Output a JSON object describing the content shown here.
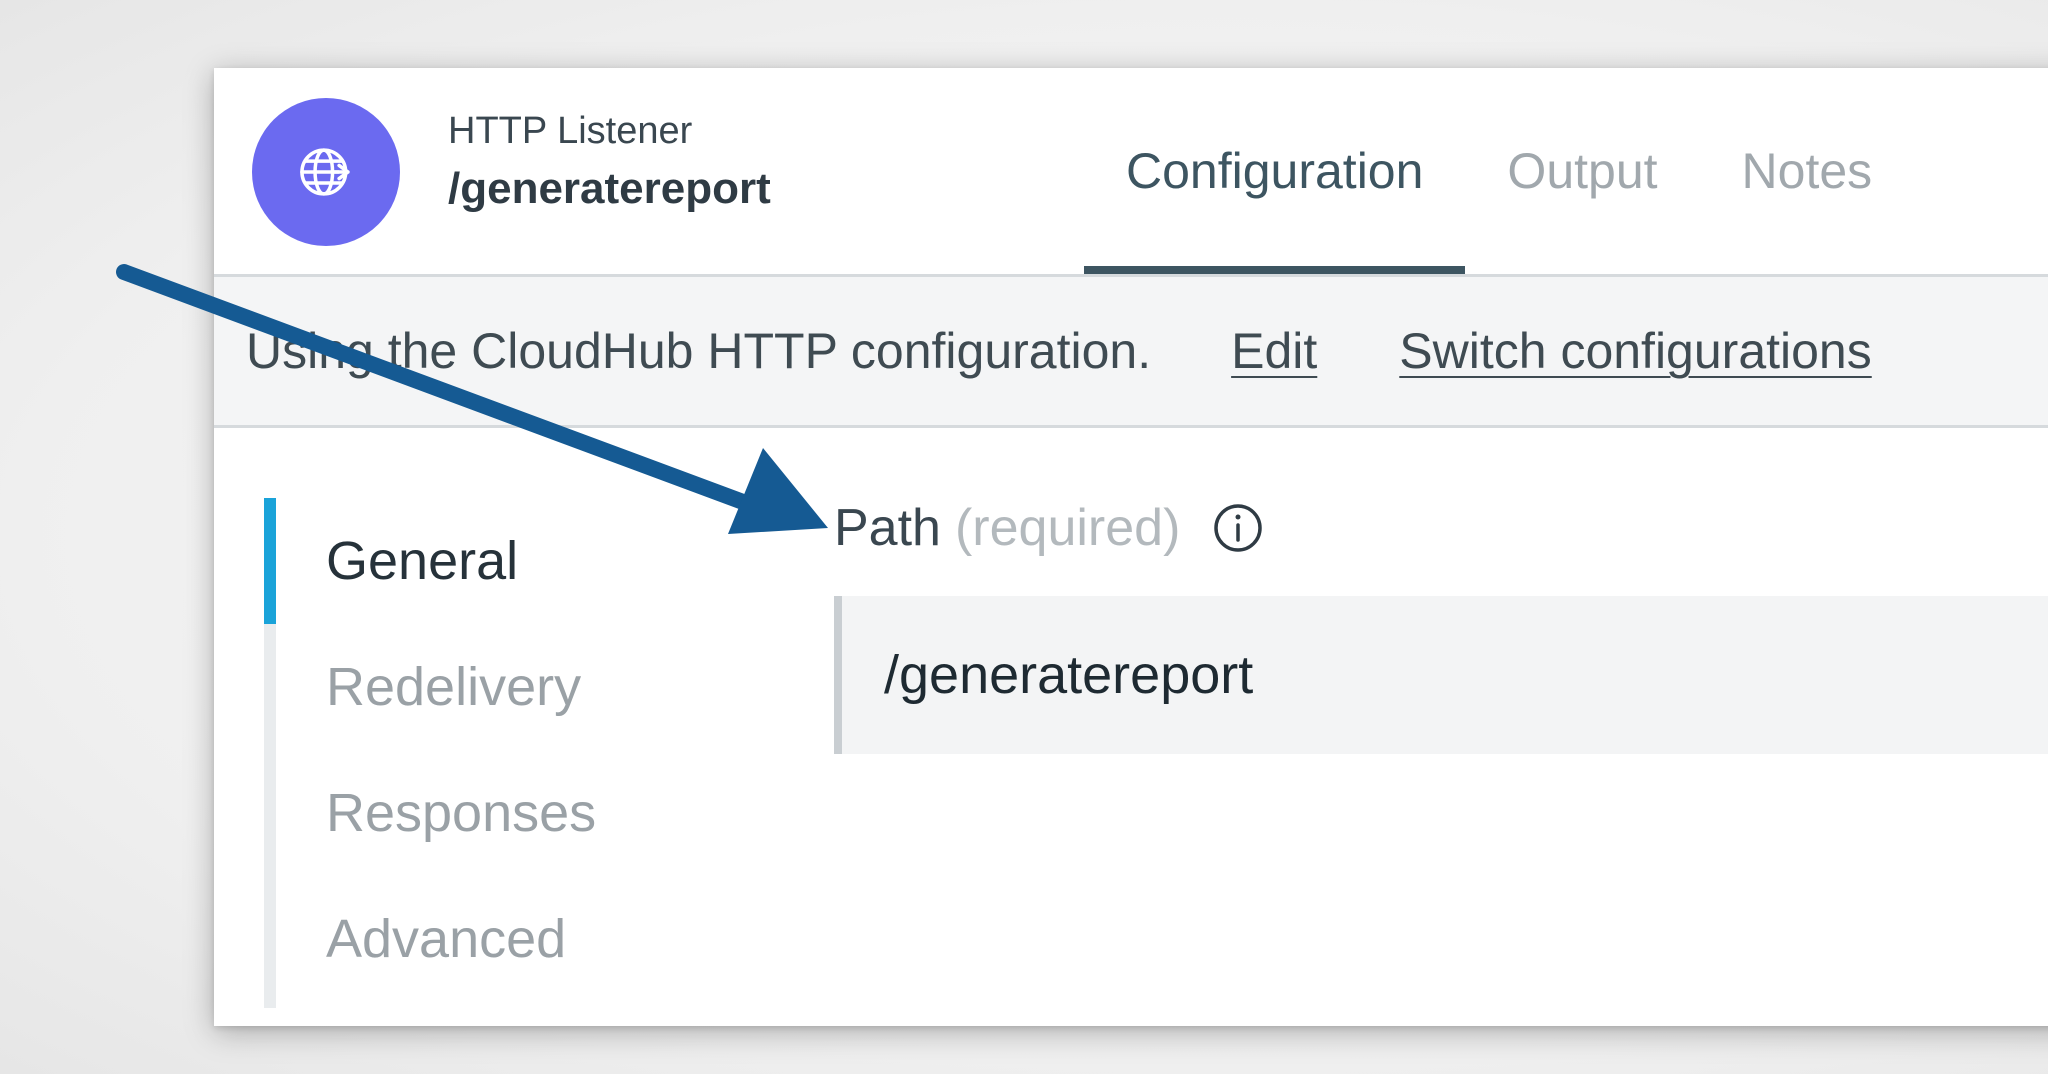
{
  "header": {
    "component_type": "HTTP Listener",
    "component_name": "/generatereport",
    "icon": "globe-arrow-icon",
    "icon_color": "#6b6af0"
  },
  "tabs": [
    {
      "label": "Configuration",
      "active": true
    },
    {
      "label": "Output",
      "active": false
    },
    {
      "label": "Notes",
      "active": false
    }
  ],
  "config_bar": {
    "text": "Using the CloudHub HTTP configuration.",
    "edit_link": "Edit",
    "switch_link": "Switch configurations"
  },
  "side_nav": [
    {
      "label": "General",
      "active": true
    },
    {
      "label": "Redelivery",
      "active": false
    },
    {
      "label": "Responses",
      "active": false
    },
    {
      "label": "Advanced",
      "active": false
    }
  ],
  "field": {
    "label": "Path",
    "required_note": "(required)",
    "value": "/generatereport"
  },
  "colors": {
    "accent": "#1aa3d9",
    "tab_active": "#3d5561",
    "arrow": "#155a93"
  }
}
